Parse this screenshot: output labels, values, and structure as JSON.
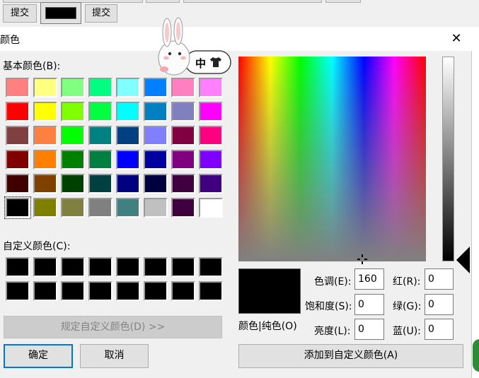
{
  "top_toolbar": {
    "submit_label_1": "提交",
    "submit_label_2": "提交",
    "color_swatch": "#000000"
  },
  "dialog": {
    "title": "颜色",
    "close_glyph": "✕",
    "basic_colors_label": "基本颜色(B):",
    "custom_colors_label": "自定义颜色(C):",
    "define_custom_label": "规定自定义颜色(D) >>",
    "ok_label": "确定",
    "cancel_label": "取消",
    "preview_label": "颜色|纯色(O)",
    "add_custom_label": "添加到自定义颜色(A)",
    "fields": {
      "hue": {
        "label": "色调(E):",
        "value": "160"
      },
      "sat": {
        "label": "饱和度(S):",
        "value": "0"
      },
      "lum": {
        "label": "亮度(L):",
        "value": "0"
      },
      "red": {
        "label": "红(R):",
        "value": "0"
      },
      "green": {
        "label": "绿(G):",
        "value": "0"
      },
      "blue": {
        "label": "蓝(U):",
        "value": "0"
      }
    },
    "selected_color": "#000000",
    "basic_colors": [
      [
        "#ff8080",
        "#ffff80",
        "#80ff80",
        "#00ff80",
        "#80ffff",
        "#0080ff",
        "#ff80c0",
        "#ff80ff"
      ],
      [
        "#ff0000",
        "#ffff00",
        "#80ff00",
        "#00ff40",
        "#00ffff",
        "#0080c0",
        "#8080c0",
        "#ff00ff"
      ],
      [
        "#804040",
        "#ff8040",
        "#00ff00",
        "#008080",
        "#004080",
        "#8080ff",
        "#800040",
        "#ff0080"
      ],
      [
        "#800000",
        "#ff8000",
        "#008000",
        "#008040",
        "#0000ff",
        "#0000a0",
        "#800080",
        "#8000ff"
      ],
      [
        "#400000",
        "#804000",
        "#004000",
        "#004040",
        "#000080",
        "#000040",
        "#400040",
        "#400080"
      ],
      [
        "#000000",
        "#808000",
        "#808040",
        "#808080",
        "#408080",
        "#c0c0c0",
        "#400040",
        "#ffffff"
      ]
    ],
    "selected_basic": [
      5,
      0
    ],
    "custom_colors": [
      [
        "#000000",
        "#000000",
        "#000000",
        "#000000",
        "#000000",
        "#000000",
        "#000000",
        "#000000"
      ],
      [
        "#000000",
        "#000000",
        "#000000",
        "#000000",
        "#000000",
        "#000000",
        "#000000",
        "#000000"
      ]
    ]
  },
  "ime": {
    "mode_label": "中",
    "shirt_icon": "shirt-icon"
  }
}
